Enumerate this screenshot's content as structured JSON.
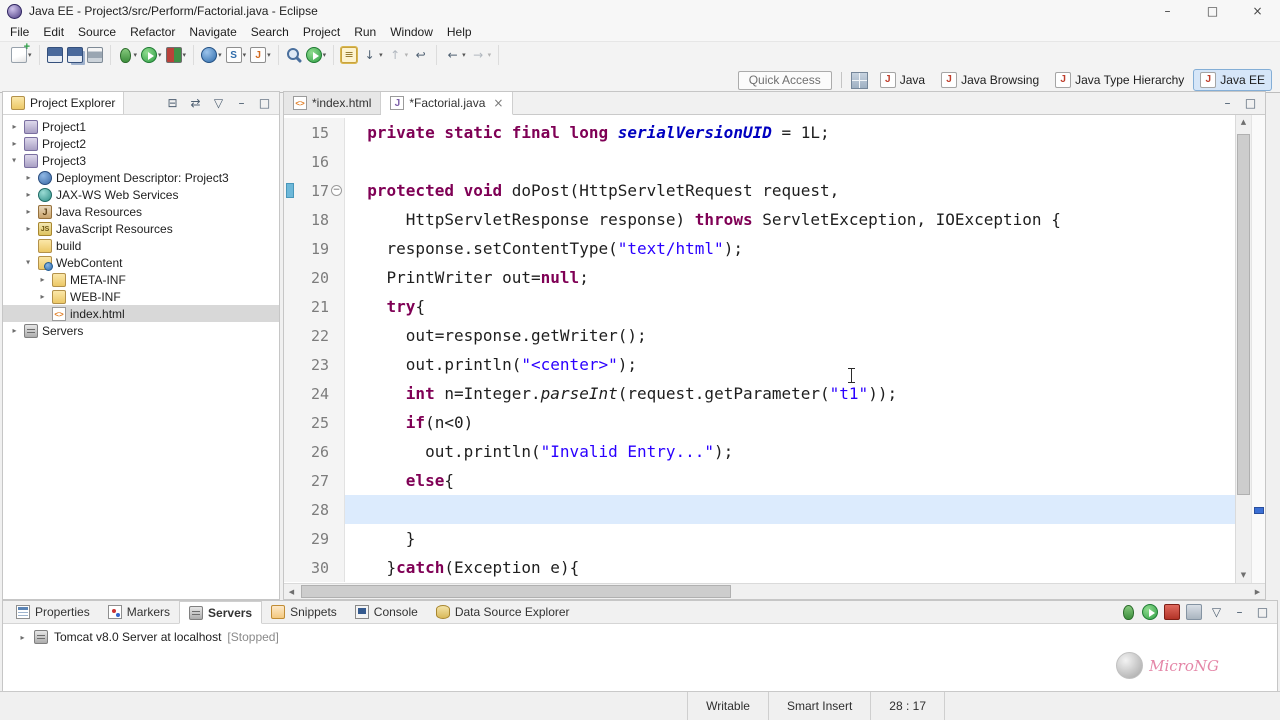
{
  "window": {
    "title": "Java EE - Project3/src/Perform/Factorial.java - Eclipse",
    "controls": [
      "minimize",
      "maximize",
      "close"
    ]
  },
  "menu": {
    "items": [
      "File",
      "Edit",
      "Source",
      "Refactor",
      "Navigate",
      "Search",
      "Project",
      "Run",
      "Window",
      "Help"
    ]
  },
  "toolbar": {
    "quick_access_label": "Quick Access",
    "groups": [
      {
        "items": [
          {
            "name": "new-wizard",
            "icon": "new",
            "dropdown": true
          }
        ]
      },
      {
        "items": [
          {
            "name": "save",
            "icon": "save"
          },
          {
            "name": "save-all",
            "icon": "save-all"
          },
          {
            "name": "print",
            "icon": "print"
          }
        ]
      },
      {
        "items": [
          {
            "name": "debug",
            "icon": "debug",
            "dropdown": true
          },
          {
            "name": "run",
            "icon": "run",
            "dropdown": true
          },
          {
            "name": "coverage",
            "icon": "coverage",
            "dropdown": true
          }
        ]
      },
      {
        "items": [
          {
            "name": "new-dynamic-web-project",
            "icon": "web-project",
            "dropdown": true
          },
          {
            "name": "new-servlet",
            "icon": "servlet",
            "dropdown": true
          },
          {
            "name": "new-jsp-file",
            "icon": "jsp",
            "dropdown": true
          }
        ]
      },
      {
        "items": [
          {
            "name": "search",
            "icon": "search"
          },
          {
            "name": "external-tools",
            "icon": "run-external",
            "dropdown": true
          }
        ]
      },
      {
        "items": [
          {
            "name": "mark-occurrences",
            "icon": "occurrences",
            "toggled": true
          },
          {
            "name": "next-annotation",
            "icon": "next-annotation",
            "dropdown": true
          },
          {
            "name": "previous-annotation",
            "icon": "prev-annotation",
            "dropdown": true,
            "disabled": true
          },
          {
            "name": "last-edit-location",
            "icon": "last-edit"
          }
        ]
      },
      {
        "items": [
          {
            "name": "back",
            "icon": "back",
            "dropdown": true
          },
          {
            "name": "forward",
            "icon": "forward",
            "dropdown": true,
            "disabled": true
          }
        ]
      }
    ]
  },
  "perspectives": {
    "items": [
      {
        "label": "Java",
        "active": false
      },
      {
        "label": "Java Browsing",
        "active": false
      },
      {
        "label": "Java Type Hierarchy",
        "active": false
      },
      {
        "label": "Java EE",
        "active": true
      }
    ]
  },
  "project_explorer": {
    "title": "Project Explorer",
    "toolbar_icons": [
      "collapse-all",
      "link-with-editor",
      "view-menu",
      "minimize",
      "maximize"
    ],
    "tree": [
      {
        "depth": 0,
        "arrow": "c",
        "icon": "project",
        "label": "Project1"
      },
      {
        "depth": 0,
        "arrow": "c",
        "icon": "project",
        "label": "Project2"
      },
      {
        "depth": 0,
        "arrow": "e",
        "icon": "project",
        "label": "Project3"
      },
      {
        "depth": 1,
        "arrow": "c",
        "icon": "deployment",
        "label": "Deployment Descriptor: Project3"
      },
      {
        "depth": 1,
        "arrow": "c",
        "icon": "webservices",
        "label": "JAX-WS Web Services"
      },
      {
        "depth": 1,
        "arrow": "c",
        "icon": "java-resources",
        "label": "Java Resources"
      },
      {
        "depth": 1,
        "arrow": "c",
        "icon": "js-resources",
        "label": "JavaScript Resources"
      },
      {
        "depth": 1,
        "arrow": "n",
        "icon": "folder",
        "label": "build"
      },
      {
        "depth": 1,
        "arrow": "e",
        "icon": "folder-web",
        "label": "WebContent"
      },
      {
        "depth": 2,
        "arrow": "c",
        "icon": "folder",
        "label": "META-INF"
      },
      {
        "depth": 2,
        "arrow": "c",
        "icon": "folder",
        "label": "WEB-INF"
      },
      {
        "depth": 2,
        "arrow": "n",
        "icon": "file-html",
        "label": "index.html",
        "selected": true
      },
      {
        "depth": 0,
        "arrow": "c",
        "icon": "servers",
        "label": "Servers"
      }
    ]
  },
  "editor": {
    "tabs": [
      {
        "label": "*index.html",
        "icon": "file-html",
        "active": false
      },
      {
        "label": "*Factorial.java",
        "icon": "file-java",
        "active": true
      }
    ],
    "toolbar_icons": [
      "minimize",
      "maximize"
    ],
    "lines": [
      {
        "n": "15",
        "seg": [
          [
            "",
            "  "
          ],
          [
            "k",
            "private static final long "
          ],
          [
            "f",
            "serialVersionUID"
          ],
          [
            "",
            " = 1L;"
          ]
        ]
      },
      {
        "n": "16",
        "seg": []
      },
      {
        "n": "17",
        "fold": true,
        "diff": true,
        "seg": [
          [
            "",
            "  "
          ],
          [
            "k",
            "protected void"
          ],
          [
            "",
            " doPost(HttpServletRequest request,"
          ]
        ]
      },
      {
        "n": "18",
        "seg": [
          [
            "",
            "      HttpServletResponse response) "
          ],
          [
            "k",
            "throws"
          ],
          [
            "",
            " ServletException, IOException {"
          ]
        ]
      },
      {
        "n": "19",
        "seg": [
          [
            "",
            "    response.setContentType("
          ],
          [
            "s",
            "\"text/html\""
          ],
          [
            "",
            ");"
          ]
        ]
      },
      {
        "n": "20",
        "seg": [
          [
            "",
            "    PrintWriter out="
          ],
          [
            "k",
            "null"
          ],
          [
            "",
            ";"
          ]
        ]
      },
      {
        "n": "21",
        "seg": [
          [
            "",
            "    "
          ],
          [
            "k",
            "try"
          ],
          [
            "",
            "{"
          ]
        ]
      },
      {
        "n": "22",
        "seg": [
          [
            "",
            "      out=response.getWriter();"
          ]
        ]
      },
      {
        "n": "23",
        "seg": [
          [
            "",
            "      out.println("
          ],
          [
            "s",
            "\"<center>\""
          ],
          [
            "",
            ");"
          ]
        ]
      },
      {
        "n": "24",
        "seg": [
          [
            "",
            "      "
          ],
          [
            "k",
            "int"
          ],
          [
            "",
            " n=Integer."
          ],
          [
            "m",
            "parseInt"
          ],
          [
            "",
            "(request.getParameter("
          ],
          [
            "s",
            "\"t1\""
          ],
          [
            "",
            "));"
          ]
        ]
      },
      {
        "n": "25",
        "seg": [
          [
            "",
            "      "
          ],
          [
            "k",
            "if"
          ],
          [
            "",
            "(n<0)"
          ]
        ]
      },
      {
        "n": "26",
        "seg": [
          [
            "",
            "        out.println("
          ],
          [
            "s",
            "\"Invalid Entry...\""
          ],
          [
            "",
            ");"
          ]
        ]
      },
      {
        "n": "27",
        "seg": [
          [
            "",
            "      "
          ],
          [
            "k",
            "else"
          ],
          [
            "",
            "{"
          ]
        ]
      },
      {
        "n": "28",
        "hl": true,
        "seg": []
      },
      {
        "n": "29",
        "seg": [
          [
            "",
            "      }"
          ]
        ]
      },
      {
        "n": "30",
        "seg": [
          [
            "",
            "    }"
          ],
          [
            "k",
            "catch"
          ],
          [
            "",
            "(Exception e){"
          ]
        ]
      }
    ]
  },
  "bottom_panel": {
    "tabs": [
      {
        "label": "Properties",
        "icon": "properties"
      },
      {
        "label": "Markers",
        "icon": "markers"
      },
      {
        "label": "Servers",
        "icon": "servers",
        "active": true
      },
      {
        "label": "Snippets",
        "icon": "snippets"
      },
      {
        "label": "Console",
        "icon": "console"
      },
      {
        "label": "Data Source Explorer",
        "icon": "data-source"
      }
    ],
    "toolbar_icons": [
      "debug-server",
      "start-server",
      "stop-server",
      "publish",
      "view-menu",
      "minimize",
      "maximize"
    ],
    "server_entry": {
      "label": "Tomcat v8.0 Server at localhost",
      "status": "[Stopped]"
    }
  },
  "status_bar": {
    "writable": "Writable",
    "insert_mode": "Smart Insert",
    "position": "28 : 17"
  },
  "watermark": {
    "label": "MicroNG"
  },
  "colors": {
    "keyword": "#7f0055",
    "string": "#2a00ff",
    "static_field": "#0000c0",
    "current_line": "#dcebfd",
    "perspective_active_bg": "#d6e6f8"
  }
}
